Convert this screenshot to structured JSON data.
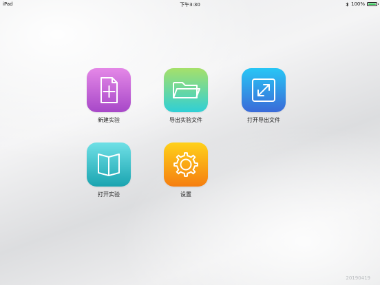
{
  "status_bar": {
    "device": "iPad",
    "time": "下午3:30",
    "battery_text": "100%",
    "battery_level": 1.0
  },
  "apps": [
    {
      "label": "新建实验",
      "icon": "new-document-icon",
      "gradient": [
        "#e488e7",
        "#a748c8"
      ]
    },
    {
      "label": "导出实验文件",
      "icon": "open-folder-icon",
      "gradient": [
        "#a6e06a",
        "#2fcfd6"
      ]
    },
    {
      "label": "打开导出文件",
      "icon": "expand-arrows-icon",
      "gradient": [
        "#28c6f5",
        "#3a6ad8"
      ]
    },
    {
      "label": "打开实验",
      "icon": "open-book-icon",
      "gradient": [
        "#6fe0e6",
        "#1aa4b0"
      ]
    },
    {
      "label": "设置",
      "icon": "gear-icon",
      "gradient": [
        "#ffd11a",
        "#f57e10"
      ]
    }
  ],
  "version": "20190419"
}
